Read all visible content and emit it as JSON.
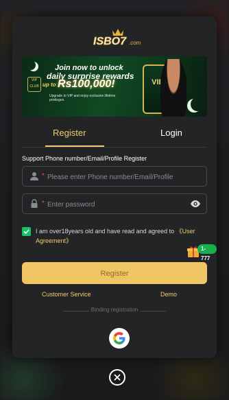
{
  "brand": {
    "logo_text": "ISBO7",
    "logo_suffix": ".com"
  },
  "banner": {
    "line1": "Join now to unlock",
    "line2": "daily surprise rewards",
    "line3": "up to",
    "amount": "Rs100,000!",
    "fineprint": "Upgrade to VIP and enjoy exclusive lifetime privileges.",
    "vip_label": "VIP",
    "vip_club": "VIP CLUB"
  },
  "tabs": [
    {
      "label": "Register",
      "active": true
    },
    {
      "label": "Login",
      "active": false
    }
  ],
  "form": {
    "support_label": "Support Phone number/Email/Profile Register",
    "account_placeholder": "Please enter Phone number/Email/Profile",
    "password_placeholder": "Enter password",
    "required_mark": "*"
  },
  "agreement": {
    "checked": true,
    "text": "I am over18years old and have read and agreed to",
    "link": "《User Agreement》"
  },
  "gift_badge": "1-777",
  "buttons": {
    "register": "Register"
  },
  "links": {
    "customer_service": "Customer Service",
    "demo": "Demo"
  },
  "binding_label": "Binding registration",
  "icons": {
    "user": "user-icon",
    "lock": "lock-icon",
    "eye": "eye-icon",
    "check": "check-icon",
    "gift": "gift-icon",
    "google": "google-icon",
    "close": "close-icon"
  },
  "colors": {
    "accent": "#f3cc6e",
    "button": "#f0c665",
    "check": "#19c267",
    "modal": "#232426"
  }
}
